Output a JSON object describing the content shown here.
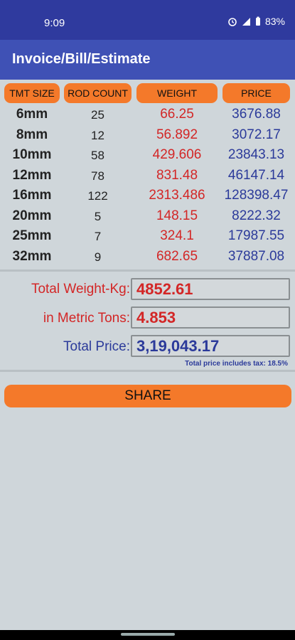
{
  "status": {
    "time": "9:09",
    "battery": "83%"
  },
  "app": {
    "title": "Invoice/Bill/Estimate"
  },
  "table": {
    "headers": {
      "size": "TMT SIZE",
      "count": "ROD COUNT",
      "weight": "WEIGHT",
      "price": "PRICE"
    },
    "rows": [
      {
        "size": "6mm",
        "count": "25",
        "weight": "66.25",
        "price": "3676.88"
      },
      {
        "size": "8mm",
        "count": "12",
        "weight": "56.892",
        "price": "3072.17"
      },
      {
        "size": "10mm",
        "count": "58",
        "weight": "429.606",
        "price": "23843.13"
      },
      {
        "size": "12mm",
        "count": "78",
        "weight": "831.48",
        "price": "46147.14"
      },
      {
        "size": "16mm",
        "count": "122",
        "weight": "2313.486",
        "price": "128398.47"
      },
      {
        "size": "20mm",
        "count": "5",
        "weight": "148.15",
        "price": "8222.32"
      },
      {
        "size": "25mm",
        "count": "7",
        "weight": "324.1",
        "price": "17987.55"
      },
      {
        "size": "32mm",
        "count": "9",
        "weight": "682.65",
        "price": "37887.08"
      }
    ]
  },
  "totals": {
    "weight_label": "Total Weight-Kg:",
    "weight_value": "4852.61",
    "tons_label": "in Metric Tons:",
    "tons_value": "4.853",
    "price_label": "Total Price:",
    "price_value": "3,19,043.17",
    "tax_note": "Total price includes tax: 18.5%"
  },
  "actions": {
    "share_label": "SHARE"
  },
  "colors": {
    "appbar": "#3f51b5",
    "accent": "#f4792a",
    "weight_text": "#d32626",
    "price_text": "#2b3a9a"
  }
}
